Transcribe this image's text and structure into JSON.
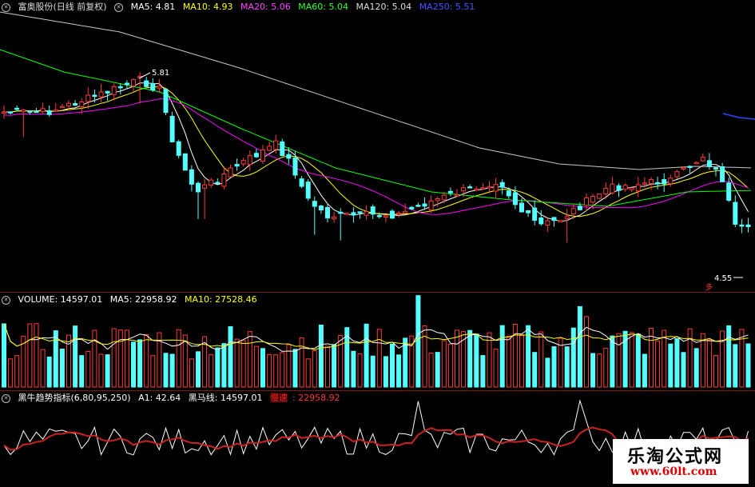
{
  "price_header": {
    "title": "富奥股份(日线 前复权)",
    "ma5": "MA5: 4.81",
    "ma10": "MA10: 4.93",
    "ma20": "MA20: 5.06",
    "ma60": "MA60: 5.04",
    "ma120": "MA120: 5.04",
    "ma250": "MA250: 5.51"
  },
  "price_marks": {
    "high": "5.81",
    "low": "4.55",
    "flag": "多"
  },
  "volume_header": {
    "title": "VOLUME: 14597.01",
    "ma5": "MA5: 22958.92",
    "ma10": "MA10: 27528.46"
  },
  "indicator_header": {
    "title": "黑牛趋势指标(6,80,95,250)",
    "a1": "A1: 42.64",
    "line": "黑马线: 14597.01",
    "slow_label": "慢速",
    "slow": ": 22958.92"
  },
  "watermark": {
    "title": "乐淘公式网",
    "url": "www.60lt.com"
  },
  "colors": {
    "up": "#ff3b3b",
    "down": "#54ffff",
    "ma5": "#ffffff",
    "ma10": "#ffff00",
    "ma20": "#ff00ff",
    "ma60": "#00ff00",
    "ma120": "#c8c8c8",
    "ma250": "#3344ff",
    "slow": "#cc2222"
  }
}
